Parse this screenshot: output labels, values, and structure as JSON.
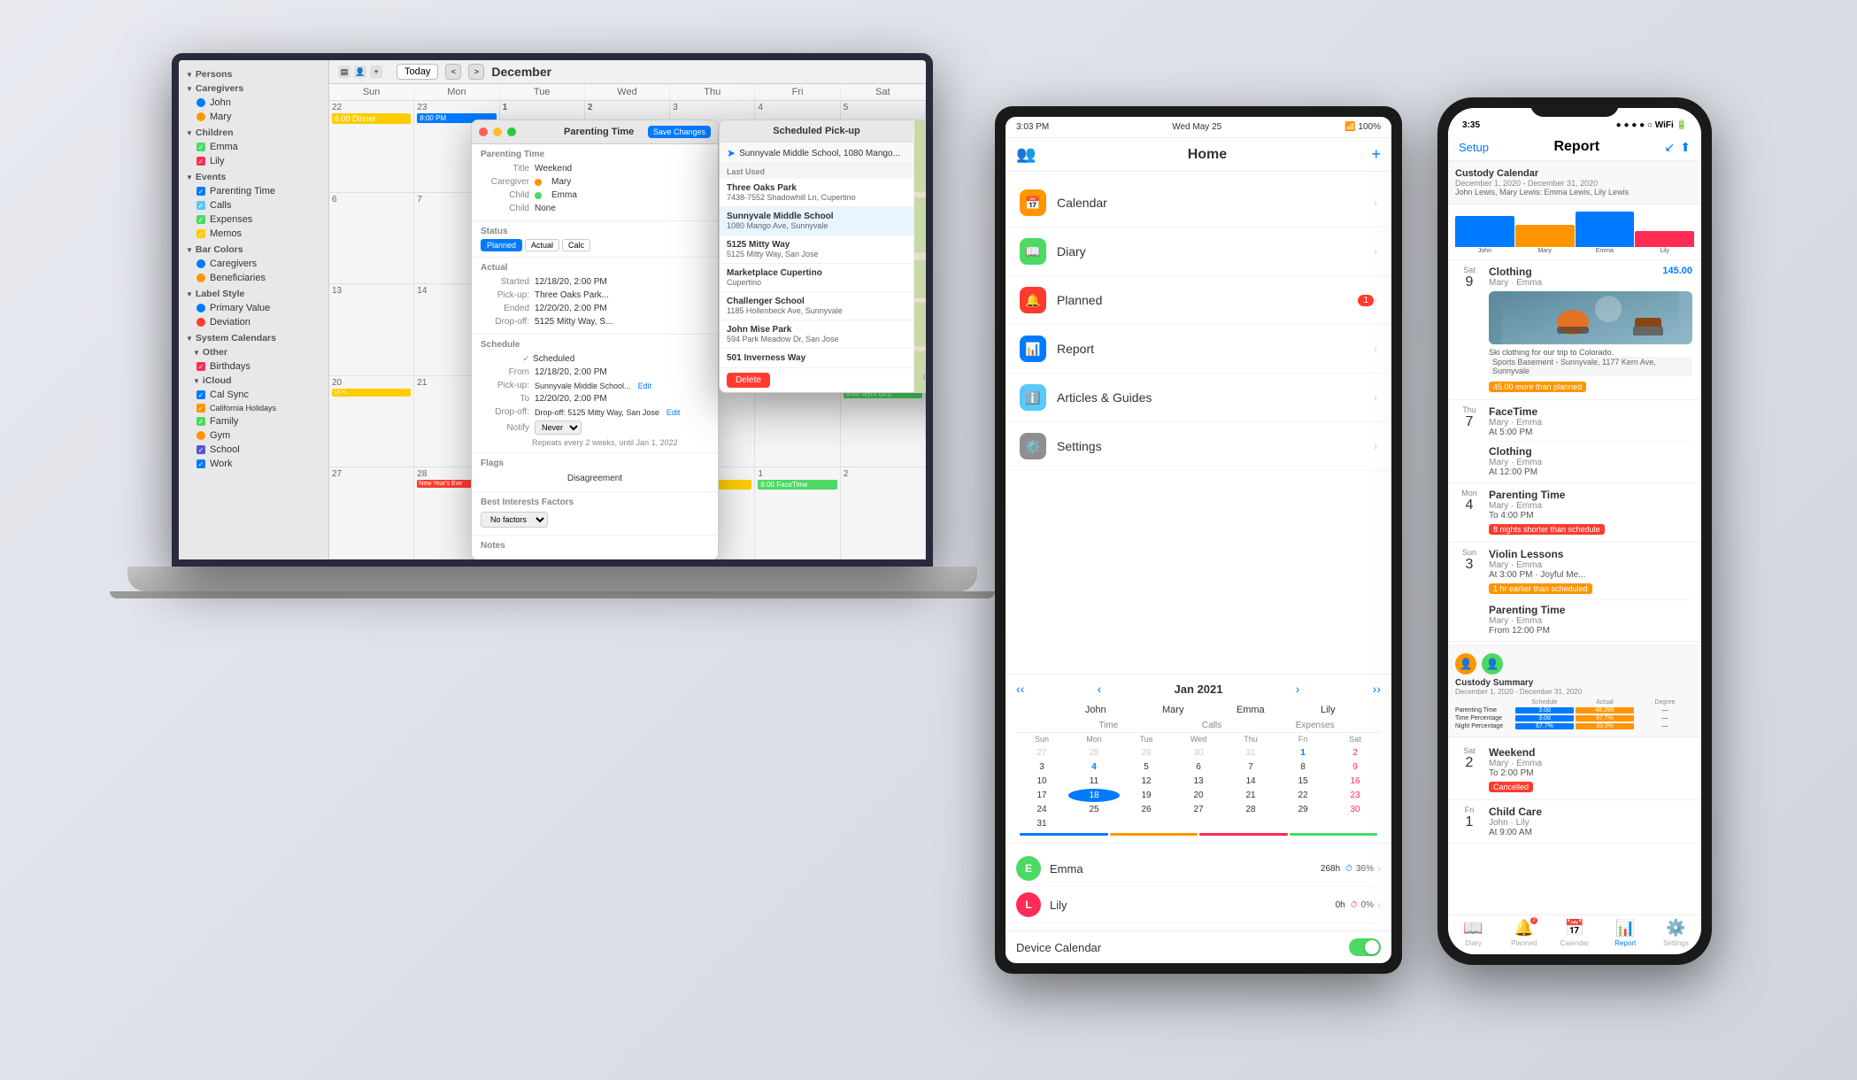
{
  "laptop": {
    "sidebar": {
      "sections": [
        {
          "title": "Persons",
          "expanded": true,
          "subsections": [
            {
              "title": "Caregivers",
              "items": [
                {
                  "label": "John",
                  "color": "#007aff",
                  "type": "dot"
                },
                {
                  "label": "Mary",
                  "color": "#ff9500",
                  "type": "dot"
                }
              ]
            },
            {
              "title": "Children",
              "items": [
                {
                  "label": "Emma",
                  "color": "#4cd964",
                  "type": "checkbox"
                },
                {
                  "label": "Lily",
                  "color": "#ff2d55",
                  "type": "checkbox"
                }
              ]
            }
          ]
        },
        {
          "title": "Events",
          "items": [
            {
              "label": "Parenting Time",
              "color": "#007aff",
              "type": "checkbox"
            },
            {
              "label": "Calls",
              "color": "#5ac8fa",
              "type": "checkbox"
            },
            {
              "label": "Expenses",
              "color": "#4cd964",
              "type": "checkbox"
            },
            {
              "label": "Memos",
              "color": "#ffcc00",
              "type": "checkbox"
            }
          ]
        },
        {
          "title": "Bar Colors",
          "items": [
            {
              "label": "Caregivers",
              "color": "#007aff",
              "type": "dot"
            },
            {
              "label": "Beneficiaries",
              "color": "#ff9500",
              "type": "dot"
            }
          ]
        },
        {
          "title": "Label Style",
          "items": [
            {
              "label": "Primary Value",
              "color": "#007aff",
              "type": "dot"
            },
            {
              "label": "Deviation",
              "color": "#ff3b30",
              "type": "dot"
            }
          ]
        },
        {
          "title": "System Calendars",
          "subsections": [
            {
              "title": "Other",
              "items": [
                {
                  "label": "Birthdays",
                  "color": "#ff2d55",
                  "type": "checkbox"
                }
              ]
            },
            {
              "title": "iCloud",
              "items": [
                {
                  "label": "Cal Sync",
                  "color": "#007aff",
                  "type": "checkbox"
                },
                {
                  "label": "California Holidays",
                  "color": "#ff9500",
                  "type": "checkbox"
                },
                {
                  "label": "Family",
                  "color": "#4cd964",
                  "type": "checkbox"
                },
                {
                  "label": "Gym",
                  "color": "#ff9500",
                  "type": "checkbox"
                },
                {
                  "label": "School",
                  "color": "#5856d6",
                  "type": "checkbox"
                },
                {
                  "label": "Work",
                  "color": "#007aff",
                  "type": "checkbox"
                }
              ]
            }
          ]
        }
      ]
    },
    "topbar": {
      "today_label": "Today",
      "month": "December",
      "nav_prev": "<",
      "nav_next": ">"
    },
    "days": [
      "Sun",
      "Mon",
      "Tue",
      "Wed",
      "Thu",
      "Fri",
      "Sat"
    ],
    "edit_panel": {
      "title": "Parenting Time",
      "toolbar_title": "Parenting Time",
      "save_label": "Save Changes",
      "title_value": "Weekend",
      "caregiver_value": "Mary",
      "child1_value": "Emma",
      "child2_value": "None",
      "status_tabs": [
        "Planned",
        "Actual",
        "Calc"
      ],
      "started_label": "Started",
      "started_value": "12/18/20, 2:00 PM",
      "pickup_label": "Pick-up:",
      "pickup_value": "Three Oaks Park...",
      "ended_label": "Ended",
      "ended_value": "12/20/20, 2:00 PM",
      "dropoff_label": "Drop-off:",
      "dropoff_value": "5125 Mitty Way, S...",
      "from_label": "From",
      "from_value": "12/18/20, 2:00 PM",
      "pickupaddr_label": "Pick-up: Sunnyvale Middle School, 108...",
      "to_label": "To",
      "to_value": "12/20/20, 2:00 PM",
      "dropaddr_label": "Drop-off: 5125 Mitty Way, San Jose",
      "notify_label": "Notify",
      "notify_value": "Never",
      "repeat_text": "Repeats every 2 weeks, until Jan 1, 2022",
      "flags_section": "Flags",
      "disagreement_label": "Disagreement",
      "best_interests_label": "Best Interests Factors",
      "no_factors_label": "No factors ▾",
      "notes_label": "Notes"
    },
    "pickup_dropdown": {
      "title": "Scheduled Pick-up",
      "search_placeholder": "Sunnyvale Middle School, 1080 Mango...",
      "last_used": "Last Used",
      "locations": [
        {
          "name": "Three Oaks Park",
          "addr1": "7438-7552 Shadowhill",
          "addr2": "Ln, Cupertino"
        },
        {
          "name": "Sunnyvale Middle School",
          "addr1": "1080 Mango",
          "addr2": "Ave, Sunnyvale"
        },
        {
          "name": "5125 Mitty Way",
          "addr1": "5125 Mitty Way",
          "addr2": "San Jose"
        },
        {
          "name": "Marketplace Cupertino",
          "addr1": "Cupertino"
        },
        {
          "name": "Challenger School",
          "addr1": "1185 Hollenbeck",
          "addr2": "Ave, Sunnyvale"
        },
        {
          "name": "John Mise Park",
          "addr1": "594 Park Meadow Dr,",
          "addr2": "San Jose"
        },
        {
          "name": "501 Inverness Way"
        }
      ],
      "delete_label": "Delete"
    }
  },
  "ipad": {
    "status": {
      "time": "3:03 PM",
      "date": "Wed May 25",
      "battery": "100%"
    },
    "header": {
      "title": "Home",
      "add_label": "+"
    },
    "nav_items": [
      {
        "label": "Calendar",
        "icon": "📅",
        "color": "#ff9500",
        "badge": null
      },
      {
        "label": "Diary",
        "icon": "📖",
        "color": "#4cd964",
        "badge": null
      },
      {
        "label": "Planned",
        "icon": "🔔",
        "color": "#ff3b30",
        "badge": "1"
      },
      {
        "label": "Report",
        "icon": "📊",
        "color": "#007aff",
        "badge": null
      },
      {
        "label": "Articles & Guides",
        "icon": "ℹ️",
        "color": "#5ac8fa",
        "badge": null
      },
      {
        "label": "Settings",
        "icon": "⚙️",
        "color": "#8e8e93",
        "badge": null
      }
    ],
    "calendar": {
      "month": "Jan 2021",
      "dow": [
        "Sun",
        "Mon",
        "Tue",
        "Wed",
        "Thu",
        "Fri",
        "Sat"
      ],
      "days": [
        [
          "",
          "",
          "",
          "",
          "",
          "1",
          "2"
        ],
        [
          "3",
          "4",
          "5",
          "6",
          "7",
          "8",
          "9"
        ],
        [
          "10",
          "11",
          "12",
          "13",
          "14",
          "15",
          "16"
        ],
        [
          "17",
          "18",
          "19",
          "20",
          "21",
          "22",
          "23"
        ],
        [
          "24",
          "25",
          "26",
          "27",
          "28",
          "29",
          "30"
        ],
        [
          "31",
          "",
          "",
          "",
          "",
          "",
          ""
        ]
      ],
      "persons_cols": [
        "John",
        "Mary",
        "Emma",
        "Lily"
      ],
      "cols": [
        "Time",
        "Calls",
        "Expenses"
      ]
    },
    "persons": [
      {
        "name": "Emma",
        "color": "#4cd964",
        "hours": "268h",
        "pct": "36%",
        "dot_color": "#4cd964"
      },
      {
        "name": "Lily",
        "color": "#ff2d55",
        "hours": "0h",
        "pct": "0%",
        "dot_color": "#ff2d55"
      }
    ],
    "device_calendar_label": "Device Calendar"
  },
  "iphone": {
    "status": {
      "time": "3:35",
      "signal": "●●●●○",
      "battery": "🔋"
    },
    "header": {
      "title": "Report",
      "left": "Setup",
      "right_icons": [
        "↙",
        "⬆"
      ]
    },
    "diary_entries": [
      {
        "date_day": "Sat",
        "date_num": "9",
        "entries": [
          {
            "title": "Clothing",
            "amount": "145.00",
            "subtitle": "Mary · Emma",
            "has_image": true,
            "desc": "Ski clothing for our trip to Colorado.",
            "location": "Sports Basement - Sunnyvale, 1177 Kern Ave, Sunnyvale",
            "over_tag": "45.00 more than planned",
            "over_color": "#ff9500"
          }
        ]
      },
      {
        "date_day": "Thu",
        "date_num": "7",
        "entries": [
          {
            "title": "FaceTime",
            "subtitle": "Mary · Emma",
            "time": "At 5:00 PM"
          },
          {
            "title": "Clothing",
            "subtitle": "Mary · Emma",
            "time": "At 12:00 PM"
          }
        ]
      },
      {
        "date_day": "Mon",
        "date_num": "4",
        "entries": [
          {
            "title": "Parenting Time",
            "subtitle": "Mary · Emma",
            "time": "To 4:00 PM",
            "tag": "8 nights shorter than schedule",
            "tag_color": "#ff3b30"
          }
        ]
      },
      {
        "date_day": "Sun",
        "date_num": "3",
        "entries": [
          {
            "title": "Violin Lessons",
            "subtitle": "Mary · Emma",
            "time": "At 3:00 PM · Joyful Me...",
            "tag": "1 hr earlier than scheduled",
            "tag_color": "#ff9500"
          },
          {
            "title": "Parenting Time",
            "subtitle": "Mary · Emma",
            "time": "From 12:00 PM"
          }
        ]
      },
      {
        "date_day": "Sat",
        "date_num": "2",
        "entries": [
          {
            "title": "Weekend",
            "subtitle": "Mary · Emma",
            "time": "To 2:00 PM",
            "tag": "Cancelled",
            "tag_color": "#ff3b30"
          }
        ]
      },
      {
        "date_day": "Fri",
        "date_num": "1",
        "entries": [
          {
            "title": "Child Care",
            "subtitle": "John · Lily",
            "time": "At 9:00 AM"
          }
        ]
      }
    ],
    "report_section": {
      "title": "Custody Calendar",
      "subtitle": "December 1, 2020 - December 31, 2020",
      "persons": "John Lewis, Mary Lewis: Emma Lewis, Lily Lewis",
      "custody_title": "Custody Summary",
      "custody_subtitle": "December 1, 2020 - December 31, 2020"
    },
    "tabbar": [
      {
        "icon": "📖",
        "label": "Diary",
        "active": false
      },
      {
        "icon": "🔔",
        "label": "Planned",
        "active": false,
        "badge": true
      },
      {
        "icon": "📅",
        "label": "Calendar",
        "active": false
      },
      {
        "icon": "📊",
        "label": "Report",
        "active": true
      },
      {
        "icon": "⚙️",
        "label": "Settings",
        "active": false
      }
    ]
  }
}
